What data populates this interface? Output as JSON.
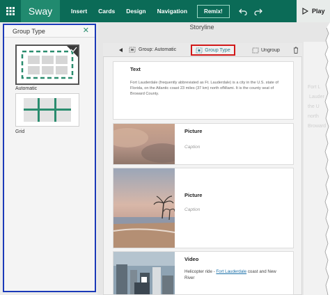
{
  "topbar": {
    "brand": "Sway",
    "menu": [
      "Insert",
      "Cards",
      "Design",
      "Navigation"
    ],
    "remix": "Remix!",
    "play": "Play"
  },
  "left_panel": {
    "title": "Group Type",
    "options": [
      {
        "label": "Automatic",
        "selected": true
      },
      {
        "label": "Grid",
        "selected": false
      }
    ]
  },
  "storyline": {
    "title": "Storyline",
    "group_toolbar": {
      "group_label": "Group: Automatic",
      "group_type_button": "Group Type",
      "ungroup_button": "Ungroup"
    },
    "cards": [
      {
        "type": "Text",
        "body": "Fort Lauderdale (frequently abbreviated as Ft. Lauderdale) is a city in the U.S. state of Florida, on the Atlantic coast 23 miles (37 km) north ofMiami. It is the county seat of Broward County."
      },
      {
        "type": "Picture",
        "caption": "Caption"
      },
      {
        "type": "Picture",
        "caption": "Caption"
      },
      {
        "type": "Video",
        "body_prefix": "Helicopter ride - ",
        "link": "Fort Lauderdale",
        "body_suffix": " coast and New River"
      }
    ]
  },
  "ghost": {
    "line1": "Fort L",
    "line2": "Lauder",
    "line3": "the U",
    "line4": "north",
    "line5": "Broward"
  },
  "colors": {
    "topbar": "#0b6b57",
    "brand": "#218a6f",
    "selection_frame": "#1a39b8",
    "highlight": "#d11919",
    "accent": "#2a8c6e"
  },
  "icons": {
    "app_launcher": "waffle-grid-icon",
    "undo": "undo-icon",
    "redo": "redo-icon",
    "play": "play-icon",
    "close": "close-icon",
    "collapse": "triangle-collapse-icon",
    "group": "group-automatic-icon",
    "group_type": "group-type-icon",
    "ungroup": "ungroup-icon",
    "delete": "trash-icon",
    "checkmark": "checkmark-icon"
  }
}
